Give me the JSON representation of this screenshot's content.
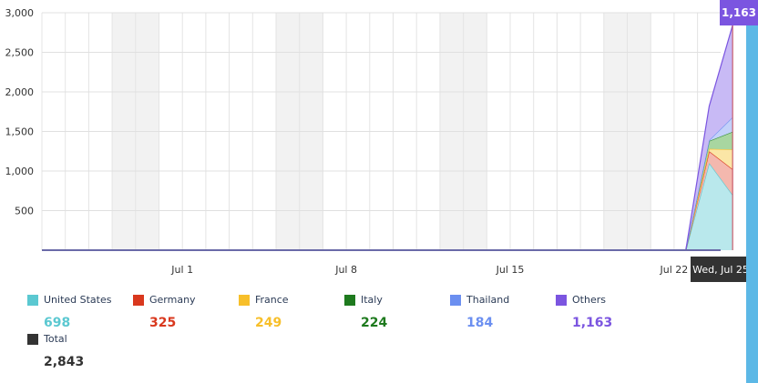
{
  "chart_data": {
    "type": "area",
    "stacked": true,
    "grid": true,
    "x_ticks": [
      "Jul 1",
      "Jul 8",
      "Jul 15",
      "Jul 22"
    ],
    "x_tick_days": [
      6,
      13,
      20,
      27
    ],
    "x_range_days": [
      0,
      30
    ],
    "ylim": [
      0,
      3000
    ],
    "y_ticks": [
      500,
      1000,
      1500,
      2000,
      2500,
      3000
    ],
    "y_tick_labels": [
      "500",
      "1,000",
      "1,500",
      "2,000",
      "2,500",
      "3,000"
    ],
    "weekend_bands_days": [
      [
        3,
        5
      ],
      [
        10,
        12
      ],
      [
        17,
        19
      ],
      [
        24,
        26
      ]
    ],
    "x_days": [
      0,
      27.5,
      28.5,
      29.5
    ],
    "series": [
      {
        "name": "United States",
        "color": "#5bc8d1",
        "fill": "#b9e8ec",
        "values": [
          0,
          0,
          1100,
          698
        ]
      },
      {
        "name": "Germany",
        "color": "#d9381e",
        "fill": "#f4b8ae",
        "values": [
          0,
          0,
          150,
          325
        ]
      },
      {
        "name": "France",
        "color": "#f7bf2a",
        "fill": "#fbe6a6",
        "values": [
          0,
          0,
          30,
          249
        ]
      },
      {
        "name": "Italy",
        "color": "#2a8a2a",
        "fill": "#a8d6a0",
        "values": [
          0,
          0,
          100,
          224
        ]
      },
      {
        "name": "Thailand",
        "color": "#6b8ff0",
        "fill": "#c3d1fa",
        "values": [
          0,
          0,
          10,
          184
        ]
      },
      {
        "name": "Others",
        "color": "#7b55e0",
        "fill": "#c8baf5",
        "values": [
          0,
          0,
          430,
          1163
        ]
      }
    ],
    "tooltip": {
      "date": "Wed, Jul 25",
      "value": "1,163"
    }
  },
  "legend": {
    "items": [
      {
        "name": "United States",
        "value": "698",
        "color": "#5bc8d1"
      },
      {
        "name": "Germany",
        "value": "325",
        "color": "#d9381e"
      },
      {
        "name": "France",
        "value": "249",
        "color": "#f7bf2a"
      },
      {
        "name": "Italy",
        "value": "224",
        "color": "#1e7a1e"
      },
      {
        "name": "Thailand",
        "value": "184",
        "color": "#6b8ff0"
      },
      {
        "name": "Others",
        "value": "1,163",
        "color": "#7b55e0"
      },
      {
        "name": "Total",
        "value": "2,843",
        "color": "#333333"
      }
    ]
  }
}
